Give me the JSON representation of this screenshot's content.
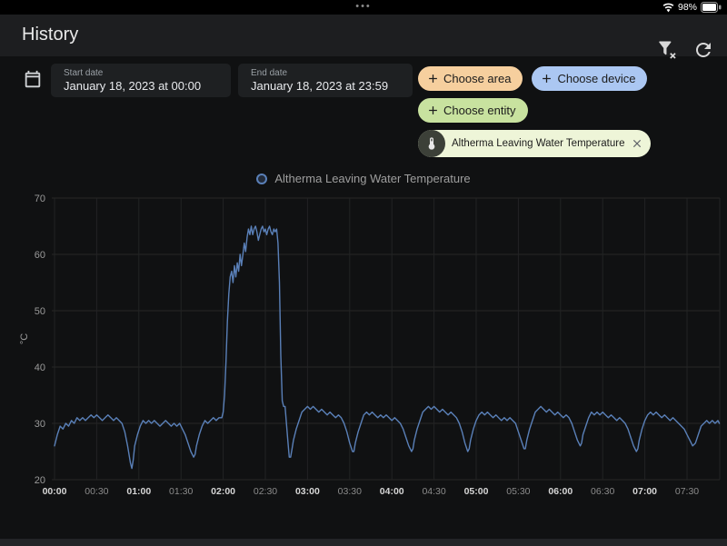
{
  "status_bar": {
    "handle_dots": "•••",
    "battery_percent": "98%"
  },
  "header": {
    "title": "History"
  },
  "date_range": {
    "start": {
      "label": "Start date",
      "value": "January 18, 2023 at 00:00"
    },
    "end": {
      "label": "End date",
      "value": "January 18, 2023 at 23:59"
    }
  },
  "filter_chips": {
    "choose_area": {
      "label": "Choose area",
      "bg": "#f6cf9e"
    },
    "choose_device": {
      "label": "Choose device",
      "bg": "#abc7f2"
    },
    "choose_entity": {
      "label": "Choose entity",
      "bg": "#c8e29f"
    },
    "selected_entity": {
      "label": "Altherma Leaving Water Temperature",
      "bg": "#eef5d8"
    }
  },
  "legend": {
    "series_label": "Altherma Leaving Water Temperature",
    "marker_color": "#5a80b8"
  },
  "chart_data": {
    "type": "line",
    "title": "Altherma Leaving Water Temperature",
    "ylabel": "°C",
    "ylim": [
      20,
      70
    ],
    "y_ticks": [
      70,
      60,
      50,
      40,
      30,
      20
    ],
    "x_ticks": [
      "00:00",
      "00:30",
      "01:00",
      "01:30",
      "02:00",
      "02:30",
      "03:00",
      "03:30",
      "04:00",
      "04:30",
      "05:00",
      "05:30",
      "06:00",
      "06:30",
      "07:00",
      "07:30"
    ],
    "x_unit": "minutes_since_midnight",
    "grid": true,
    "legend_position": "top",
    "line_color": "#5a80b8",
    "series": [
      {
        "name": "Altherma Leaving Water Temperature",
        "points": [
          [
            0,
            26
          ],
          [
            2,
            28
          ],
          [
            4,
            29.5
          ],
          [
            6,
            29
          ],
          [
            8,
            30
          ],
          [
            10,
            29.5
          ],
          [
            12,
            30.5
          ],
          [
            14,
            30
          ],
          [
            16,
            31
          ],
          [
            18,
            30.5
          ],
          [
            20,
            31
          ],
          [
            22,
            30.5
          ],
          [
            24,
            31
          ],
          [
            26,
            31.5
          ],
          [
            28,
            31
          ],
          [
            30,
            31.5
          ],
          [
            32,
            31
          ],
          [
            34,
            30.5
          ],
          [
            36,
            31
          ],
          [
            38,
            31.5
          ],
          [
            40,
            31
          ],
          [
            42,
            30.5
          ],
          [
            44,
            31
          ],
          [
            46,
            30.5
          ],
          [
            48,
            30
          ],
          [
            50,
            28.5
          ],
          [
            52,
            26
          ],
          [
            54,
            23
          ],
          [
            55,
            22
          ],
          [
            56,
            23.5
          ],
          [
            57,
            26
          ],
          [
            59,
            28
          ],
          [
            61,
            29.5
          ],
          [
            63,
            30.5
          ],
          [
            65,
            30
          ],
          [
            67,
            30.5
          ],
          [
            69,
            30
          ],
          [
            71,
            30.5
          ],
          [
            73,
            30
          ],
          [
            75,
            29.5
          ],
          [
            77,
            30
          ],
          [
            79,
            30.5
          ],
          [
            81,
            30
          ],
          [
            83,
            29.5
          ],
          [
            85,
            30
          ],
          [
            87,
            29.5
          ],
          [
            89,
            30
          ],
          [
            91,
            29
          ],
          [
            93,
            28
          ],
          [
            95,
            26.5
          ],
          [
            97,
            25
          ],
          [
            99,
            24
          ],
          [
            100,
            24.5
          ],
          [
            101,
            26
          ],
          [
            103,
            28
          ],
          [
            105,
            29.5
          ],
          [
            107,
            30.5
          ],
          [
            109,
            30
          ],
          [
            111,
            30.5
          ],
          [
            113,
            31
          ],
          [
            115,
            30.5
          ],
          [
            117,
            31
          ],
          [
            119,
            31
          ],
          [
            120,
            32
          ],
          [
            121,
            35
          ],
          [
            122,
            41
          ],
          [
            123,
            48
          ],
          [
            124,
            53
          ],
          [
            125,
            56
          ],
          [
            126,
            57
          ],
          [
            127,
            55
          ],
          [
            128,
            58
          ],
          [
            129,
            56
          ],
          [
            130,
            58.5
          ],
          [
            131,
            57
          ],
          [
            132,
            60
          ],
          [
            133,
            58
          ],
          [
            134,
            60
          ],
          [
            135,
            62
          ],
          [
            136,
            60.5
          ],
          [
            137,
            63
          ],
          [
            138,
            64.5
          ],
          [
            139,
            63.5
          ],
          [
            140,
            65
          ],
          [
            141,
            63.5
          ],
          [
            142,
            64.5
          ],
          [
            143,
            65
          ],
          [
            144,
            64
          ],
          [
            145,
            62.5
          ],
          [
            146,
            63.5
          ],
          [
            147,
            64.5
          ],
          [
            148,
            65
          ],
          [
            149,
            64
          ],
          [
            150,
            64.5
          ],
          [
            151,
            63.5
          ],
          [
            152,
            64.5
          ],
          [
            153,
            65
          ],
          [
            154,
            64
          ],
          [
            155,
            63.5
          ],
          [
            156,
            64.5
          ],
          [
            157,
            64
          ],
          [
            158,
            64.5
          ],
          [
            159,
            62
          ],
          [
            160,
            55
          ],
          [
            161,
            42
          ],
          [
            162,
            34
          ],
          [
            163,
            33
          ],
          [
            164,
            33
          ],
          [
            165,
            30
          ],
          [
            166,
            27
          ],
          [
            167,
            24
          ],
          [
            168,
            24
          ],
          [
            169,
            25.5
          ],
          [
            170,
            27
          ],
          [
            172,
            29
          ],
          [
            174,
            30.5
          ],
          [
            176,
            32
          ],
          [
            178,
            32.5
          ],
          [
            180,
            33
          ],
          [
            182,
            32.5
          ],
          [
            184,
            33
          ],
          [
            186,
            32.5
          ],
          [
            188,
            32
          ],
          [
            190,
            32.5
          ],
          [
            192,
            32
          ],
          [
            194,
            31.5
          ],
          [
            196,
            32
          ],
          [
            198,
            31.5
          ],
          [
            200,
            31
          ],
          [
            202,
            31.5
          ],
          [
            204,
            31
          ],
          [
            206,
            30
          ],
          [
            208,
            28.5
          ],
          [
            210,
            26.5
          ],
          [
            212,
            25
          ],
          [
            213,
            25
          ],
          [
            214,
            26.5
          ],
          [
            216,
            28.5
          ],
          [
            218,
            30
          ],
          [
            220,
            31.5
          ],
          [
            222,
            32
          ],
          [
            224,
            31.5
          ],
          [
            226,
            32
          ],
          [
            228,
            31.5
          ],
          [
            230,
            31
          ],
          [
            232,
            31.5
          ],
          [
            234,
            31
          ],
          [
            236,
            31.5
          ],
          [
            238,
            31
          ],
          [
            240,
            30.5
          ],
          [
            242,
            31
          ],
          [
            244,
            30.5
          ],
          [
            246,
            30
          ],
          [
            248,
            29
          ],
          [
            250,
            27.5
          ],
          [
            252,
            26
          ],
          [
            254,
            25
          ],
          [
            255,
            25.5
          ],
          [
            256,
            27
          ],
          [
            258,
            29
          ],
          [
            260,
            30.5
          ],
          [
            262,
            32
          ],
          [
            264,
            32.5
          ],
          [
            266,
            33
          ],
          [
            268,
            32.5
          ],
          [
            270,
            33
          ],
          [
            272,
            32.5
          ],
          [
            274,
            32
          ],
          [
            276,
            32.5
          ],
          [
            278,
            32
          ],
          [
            280,
            31.5
          ],
          [
            282,
            32
          ],
          [
            284,
            31.5
          ],
          [
            286,
            31
          ],
          [
            288,
            30
          ],
          [
            290,
            28.5
          ],
          [
            292,
            26.5
          ],
          [
            294,
            25
          ],
          [
            295,
            25.5
          ],
          [
            296,
            27
          ],
          [
            298,
            29
          ],
          [
            300,
            30.5
          ],
          [
            302,
            31.5
          ],
          [
            304,
            32
          ],
          [
            306,
            31.5
          ],
          [
            308,
            32
          ],
          [
            310,
            31.5
          ],
          [
            312,
            31
          ],
          [
            314,
            31.5
          ],
          [
            316,
            31
          ],
          [
            318,
            30.5
          ],
          [
            320,
            31
          ],
          [
            322,
            30.5
          ],
          [
            324,
            31
          ],
          [
            326,
            30.5
          ],
          [
            328,
            30
          ],
          [
            330,
            28.5
          ],
          [
            332,
            27
          ],
          [
            334,
            25.5
          ],
          [
            335,
            25.5
          ],
          [
            336,
            27
          ],
          [
            338,
            29
          ],
          [
            340,
            30.5
          ],
          [
            342,
            32
          ],
          [
            344,
            32.5
          ],
          [
            346,
            33
          ],
          [
            348,
            32.5
          ],
          [
            350,
            32
          ],
          [
            352,
            32.5
          ],
          [
            354,
            32
          ],
          [
            356,
            31.5
          ],
          [
            358,
            32
          ],
          [
            360,
            31.5
          ],
          [
            362,
            31
          ],
          [
            364,
            31.5
          ],
          [
            366,
            31
          ],
          [
            368,
            30
          ],
          [
            370,
            28.5
          ],
          [
            372,
            27
          ],
          [
            374,
            26
          ],
          [
            375,
            26.5
          ],
          [
            376,
            28
          ],
          [
            378,
            29.5
          ],
          [
            380,
            31
          ],
          [
            382,
            32
          ],
          [
            384,
            31.5
          ],
          [
            386,
            32
          ],
          [
            388,
            31.5
          ],
          [
            390,
            32
          ],
          [
            392,
            31.5
          ],
          [
            394,
            31
          ],
          [
            396,
            31.5
          ],
          [
            398,
            31
          ],
          [
            400,
            30.5
          ],
          [
            402,
            31
          ],
          [
            404,
            30.5
          ],
          [
            406,
            30
          ],
          [
            408,
            29
          ],
          [
            410,
            27.5
          ],
          [
            412,
            26
          ],
          [
            414,
            25
          ],
          [
            415,
            25.5
          ],
          [
            416,
            27
          ],
          [
            418,
            29
          ],
          [
            420,
            30.5
          ],
          [
            422,
            31.5
          ],
          [
            424,
            32
          ],
          [
            426,
            31.5
          ],
          [
            428,
            32
          ],
          [
            430,
            31.5
          ],
          [
            432,
            31
          ],
          [
            434,
            31.5
          ],
          [
            436,
            31
          ],
          [
            438,
            30.5
          ],
          [
            440,
            31
          ],
          [
            442,
            30.5
          ],
          [
            444,
            30
          ],
          [
            446,
            29.5
          ],
          [
            448,
            29
          ],
          [
            450,
            28
          ],
          [
            452,
            27
          ],
          [
            454,
            26
          ],
          [
            456,
            26.5
          ],
          [
            458,
            28
          ],
          [
            460,
            29.5
          ],
          [
            462,
            30
          ],
          [
            464,
            30.5
          ],
          [
            466,
            30
          ],
          [
            468,
            30.5
          ],
          [
            470,
            30
          ],
          [
            472,
            30.5
          ],
          [
            473,
            30
          ]
        ]
      }
    ]
  }
}
